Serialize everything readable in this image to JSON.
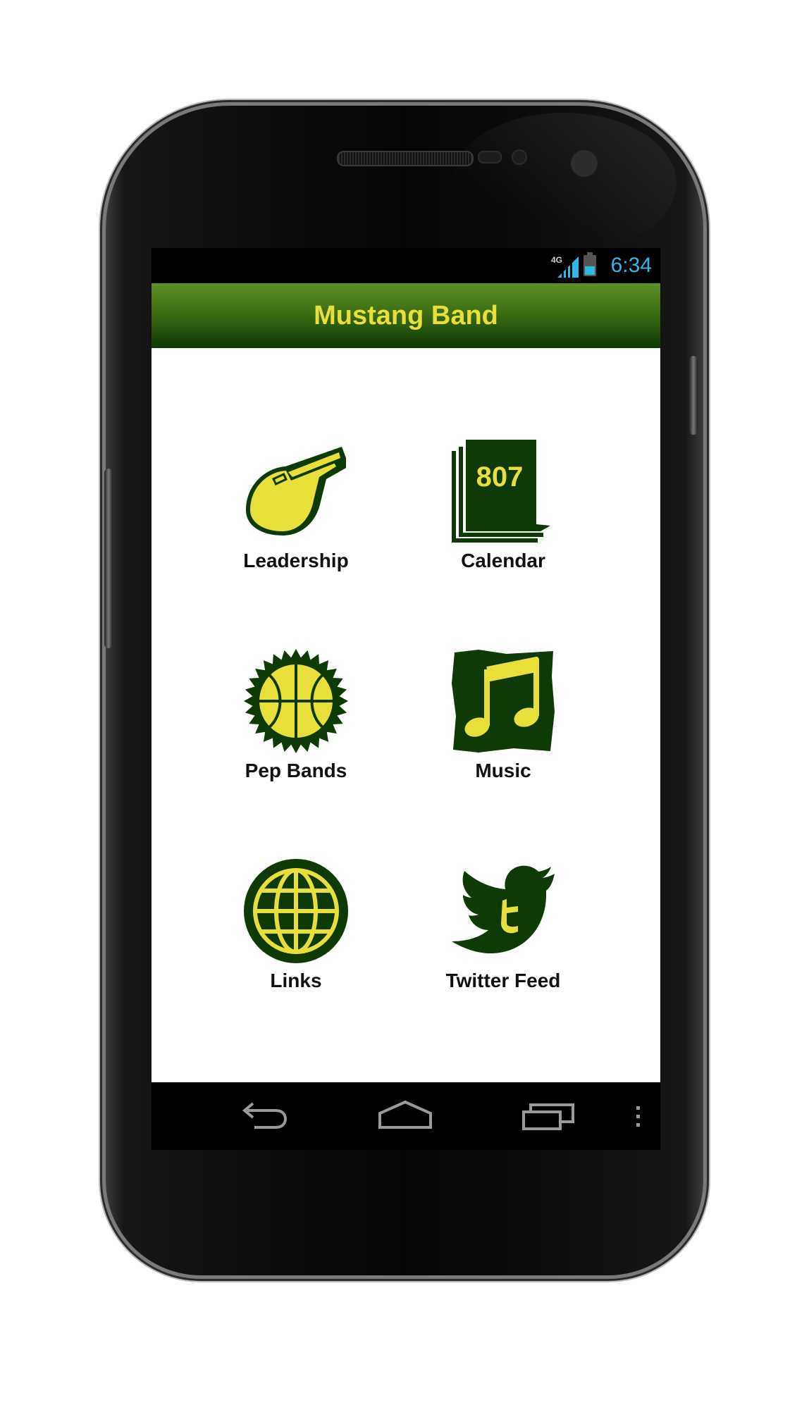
{
  "status_bar": {
    "network": "4G",
    "time": "6:34"
  },
  "action_bar": {
    "title": "Mustang Band"
  },
  "menu": {
    "items": [
      {
        "label": "Leadership",
        "icon": "whistle-icon"
      },
      {
        "label": "Calendar",
        "icon": "calendar-icon"
      },
      {
        "label": "Pep Bands",
        "icon": "basketball-icon"
      },
      {
        "label": "Music",
        "icon": "music-note-icon"
      },
      {
        "label": "Links",
        "icon": "globe-icon"
      },
      {
        "label": "Twitter Feed",
        "icon": "twitter-bird-icon"
      }
    ],
    "calendar_icon_text": "807"
  },
  "nav_bar": {
    "buttons": [
      "back-icon",
      "home-icon",
      "recent-apps-icon",
      "overflow-menu-icon"
    ]
  },
  "colors": {
    "theme_dark_green": "#0e3a05",
    "theme_yellow": "#e8df3a",
    "status_blue": "#33b5e5"
  }
}
